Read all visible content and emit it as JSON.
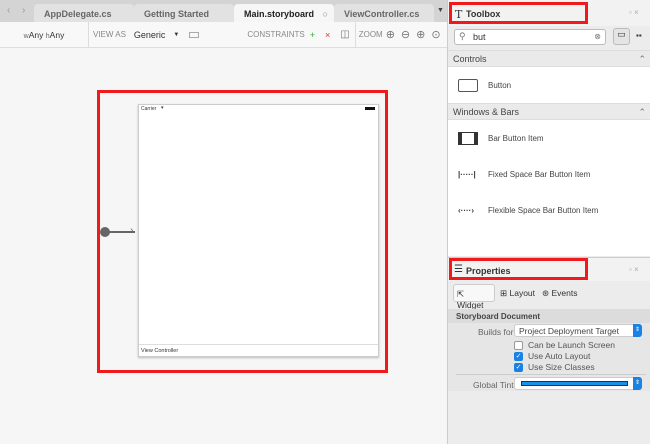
{
  "tabs": [
    {
      "label": "AppDelegate.cs"
    },
    {
      "label": "Getting Started"
    },
    {
      "label": "Main.storyboard"
    },
    {
      "label": "ViewController.cs"
    }
  ],
  "toolbar": {
    "size_class_w": "wAny",
    "size_class_h": "hAny",
    "w_prefix": "w",
    "w_value": "Any",
    "h_prefix": "h",
    "h_value": "Any",
    "view_as_label": "VIEW AS",
    "view_as_value": "Generic",
    "constraints_label": "CONSTRAINTS",
    "zoom_label": "ZOOM"
  },
  "canvas": {
    "carrier": "Carrier",
    "controller_label": "View Controller"
  },
  "toolbox": {
    "title": "Toolbox",
    "search_value": "but",
    "sections": [
      {
        "title": "Controls",
        "items": [
          {
            "label": "Button"
          }
        ]
      },
      {
        "title": "Windows & Bars",
        "items": [
          {
            "label": "Bar Button Item"
          },
          {
            "label": "Fixed Space Bar Button Item"
          },
          {
            "label": "Flexible Space Bar Button Item"
          }
        ]
      }
    ]
  },
  "properties": {
    "title": "Properties",
    "tabs": [
      {
        "label": "Widget"
      },
      {
        "label": "Layout"
      },
      {
        "label": "Events"
      }
    ],
    "section": "Storyboard Document",
    "builds_for_label": "Builds for",
    "builds_for_value": "Project Deployment Target",
    "checkboxes": [
      {
        "label": "Can be Launch Screen",
        "checked": false
      },
      {
        "label": "Use Auto Layout",
        "checked": true
      },
      {
        "label": "Use Size Classes",
        "checked": true
      }
    ],
    "global_tint_label": "Global Tint",
    "global_tint_color": "#1a8fe6"
  }
}
